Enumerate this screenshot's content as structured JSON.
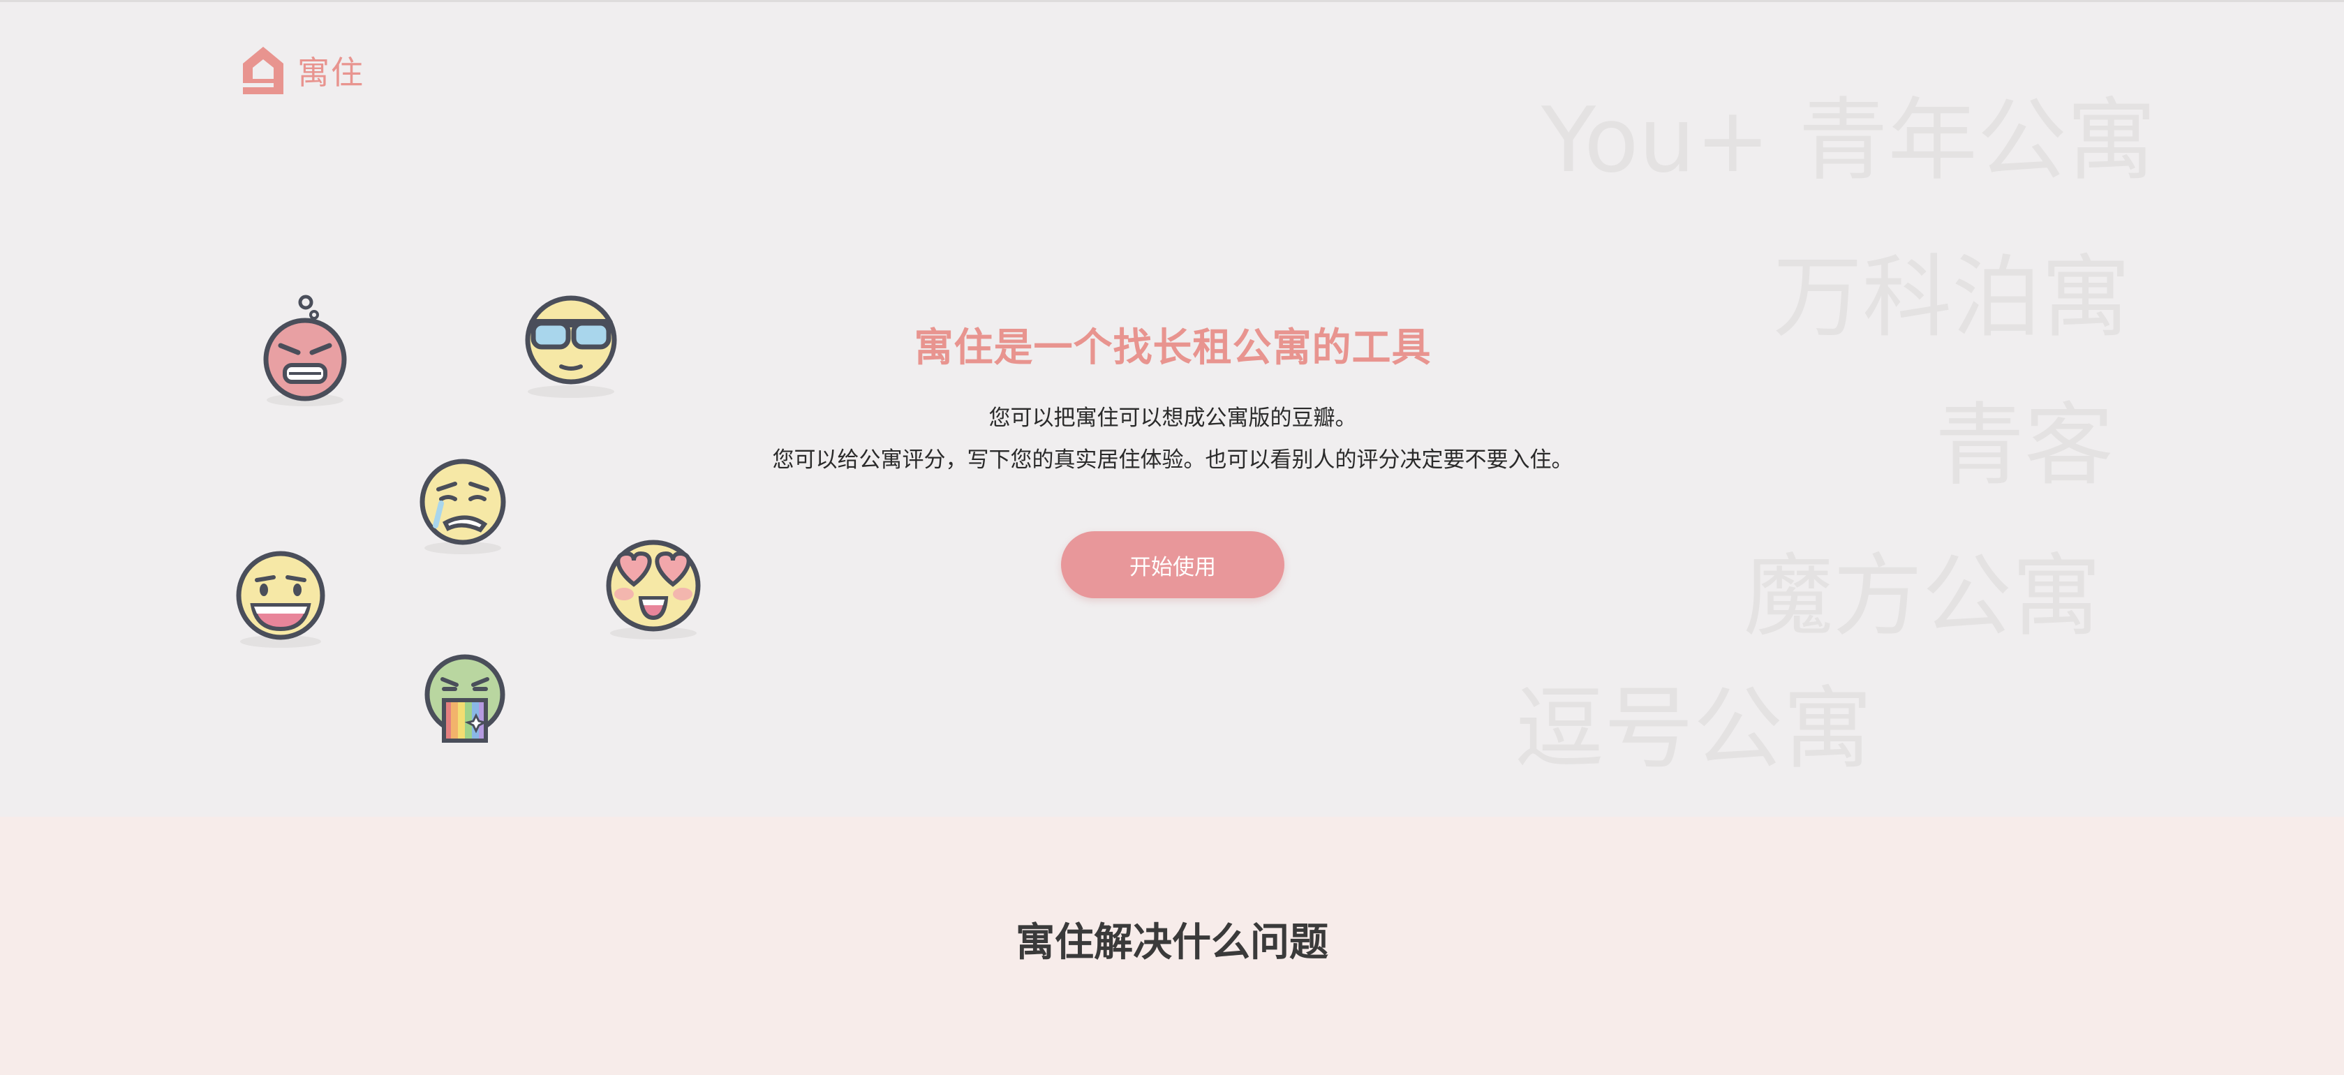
{
  "brand": {
    "name": "寓住",
    "color": "#e8948f"
  },
  "background_names": [
    "You+ 青年公寓",
    "万科泊寓",
    "青客",
    "魔方公寓",
    "逗号公寓"
  ],
  "hero": {
    "title": "寓住是一个找长租公寓的工具",
    "description_line1": "您可以把寓住可以想成公寓版的豆瓣。",
    "description_line2": "您可以给公寓评分，写下您的真实居住体验。也可以看别人的评分决定要不要入住。",
    "cta_label": "开始使用",
    "cta_color": "#e8979a"
  },
  "section2": {
    "title": "寓住解决什么问题",
    "background": "#f7ecea"
  },
  "emojis": [
    {
      "name": "angry-face-icon"
    },
    {
      "name": "sunglasses-face-icon"
    },
    {
      "name": "crying-face-icon"
    },
    {
      "name": "laughing-face-icon"
    },
    {
      "name": "heart-eyes-face-icon"
    },
    {
      "name": "vomiting-rainbow-face-icon"
    }
  ]
}
